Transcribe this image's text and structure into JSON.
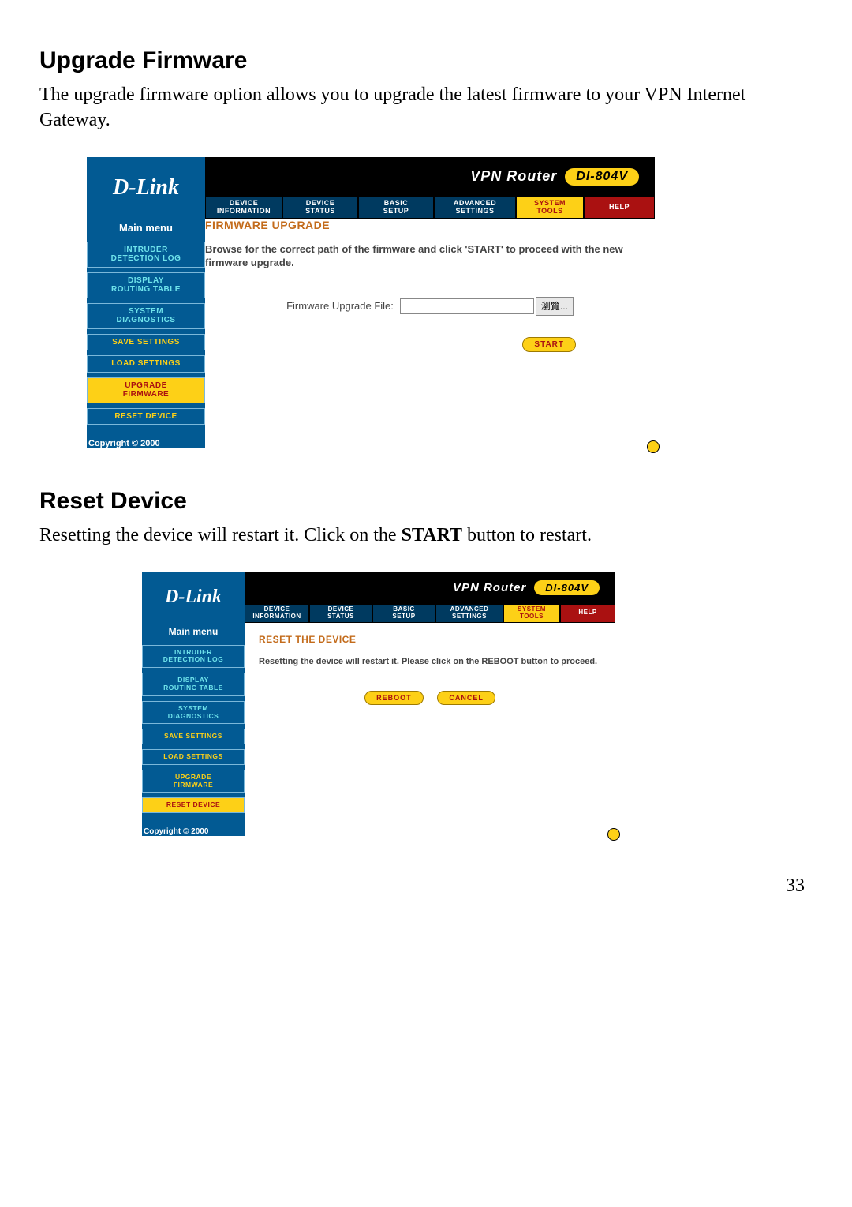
{
  "doc": {
    "section1_title": "Upgrade Firmware",
    "section1_text": "The upgrade firmware option allows you to upgrade the latest firmware to your VPN Internet Gateway.",
    "section2_title": "Reset Device",
    "section2_text_a": "Resetting the device will restart it. Click on the ",
    "section2_bold": "START",
    "section2_text_b": " button to restart.",
    "page_number": "33"
  },
  "brand": {
    "logo": "D-Link",
    "vpn_label": "VPN Router",
    "model": "DI-804V"
  },
  "tabs": {
    "t1a": "DEVICE",
    "t1b": "INFORMATION",
    "t2a": "DEVICE",
    "t2b": "STATUS",
    "t3a": "BASIC",
    "t3b": "SETUP",
    "t4a": "ADVANCED",
    "t4b": "SETTINGS",
    "t5a": "SYSTEM",
    "t5b": "TOOLS",
    "t6": "HELP"
  },
  "sidebar": {
    "main_menu": "Main menu",
    "intruder_a": "INTRUDER",
    "intruder_b": "DETECTION LOG",
    "display_a": "DISPLAY",
    "display_b": "ROUTING TABLE",
    "diag_a": "SYSTEM",
    "diag_b": "DIAGNOSTICS",
    "save": "SAVE SETTINGS",
    "load": "LOAD SETTINGS",
    "upgrade_a": "UPGRADE",
    "upgrade_b": "FIRMWARE",
    "reset": "RESET DEVICE",
    "copyright": "Copyright © 2000"
  },
  "shot1": {
    "title": "FIRMWARE UPGRADE",
    "desc": "Browse for the correct path of the firmware and click 'START' to proceed with the new firmware upgrade.",
    "file_label": "Firmware Upgrade File:",
    "browse": "瀏覽...",
    "start": "START"
  },
  "shot2": {
    "title": "RESET THE DEVICE",
    "desc": "Resetting the device will restart it. Please click on the REBOOT button to proceed.",
    "reboot": "REBOOT",
    "cancel": "CANCEL"
  }
}
